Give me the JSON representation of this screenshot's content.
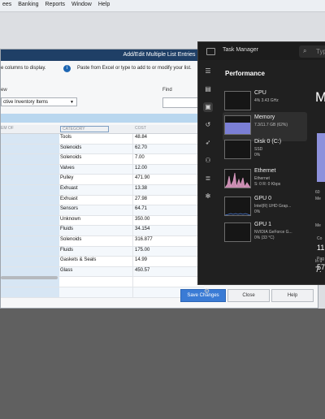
{
  "menubar": {
    "items": [
      "ees",
      "Banking",
      "Reports",
      "Window",
      "Help"
    ]
  },
  "dialog": {
    "title": "Add/Edit Multiple List Entries",
    "hint_columns": "e columns to display.",
    "hint_paste": "Paste from Excel or type to add to or modify your list.",
    "view_label": "ew",
    "view_value": "ctive Inventory Items",
    "find_label": "Find",
    "headers": {
      "subitem": "EM OF",
      "category": "CATEGORY",
      "cost": "COST"
    },
    "rows": [
      {
        "category": "Tools",
        "cost": "48.84"
      },
      {
        "category": "Solenoids",
        "cost": "62.70"
      },
      {
        "category": "Solenoids",
        "cost": "7.00"
      },
      {
        "category": "Valves",
        "cost": "12.00"
      },
      {
        "category": "Pulley",
        "cost": "471.90"
      },
      {
        "category": "Exhuast",
        "cost": "13.38"
      },
      {
        "category": "Exhuast",
        "cost": "27.98"
      },
      {
        "category": "Sensors",
        "cost": "64.71"
      },
      {
        "category": "Unknown",
        "cost": "350.00"
      },
      {
        "category": "Fluids",
        "cost": "34.154"
      },
      {
        "category": "Solenoids",
        "cost": "316.877"
      },
      {
        "category": "Fluids",
        "cost": "175.00"
      },
      {
        "category": "Gaskets & Seals",
        "cost": "14.99"
      },
      {
        "category": "Glass",
        "cost": "450.57"
      },
      {
        "category": "",
        "cost": ""
      },
      {
        "category": "",
        "cost": ""
      }
    ],
    "buttons": {
      "save": "Save Changes",
      "close": "Close",
      "help": "Help"
    }
  },
  "task_manager": {
    "title": "Task Manager",
    "search_placeholder": "Typ",
    "section": "Performance",
    "tiles": [
      {
        "name": "CPU",
        "line1": "4% 3.43 GHz",
        "line2": ""
      },
      {
        "name": "Memory",
        "line1": "7.3/11.7 GB (62%)",
        "line2": ""
      },
      {
        "name": "Disk 0 (C:)",
        "line1": "SSD",
        "line2": "0%"
      },
      {
        "name": "Ethernet",
        "line1": "Ethernet",
        "line2": "S: 0 R: 0 Kbps"
      },
      {
        "name": "GPU 0",
        "line1": "Intel(R) UHD Grap...",
        "line2": "0%"
      },
      {
        "name": "GPU 1",
        "line1": "NVIDIA GeForce G...",
        "line2": "0% (33 °C)"
      }
    ],
    "memory_percent": 62,
    "detail": {
      "heading": "M",
      "label_60": "60",
      "label_me1": "Me",
      "label_me2": "Me",
      "in_use_label": "In u",
      "in_use_value": "7.",
      "committed_label": "Co",
      "committed_value": "11",
      "paged_label": "Pag",
      "paged_value": "57"
    }
  }
}
